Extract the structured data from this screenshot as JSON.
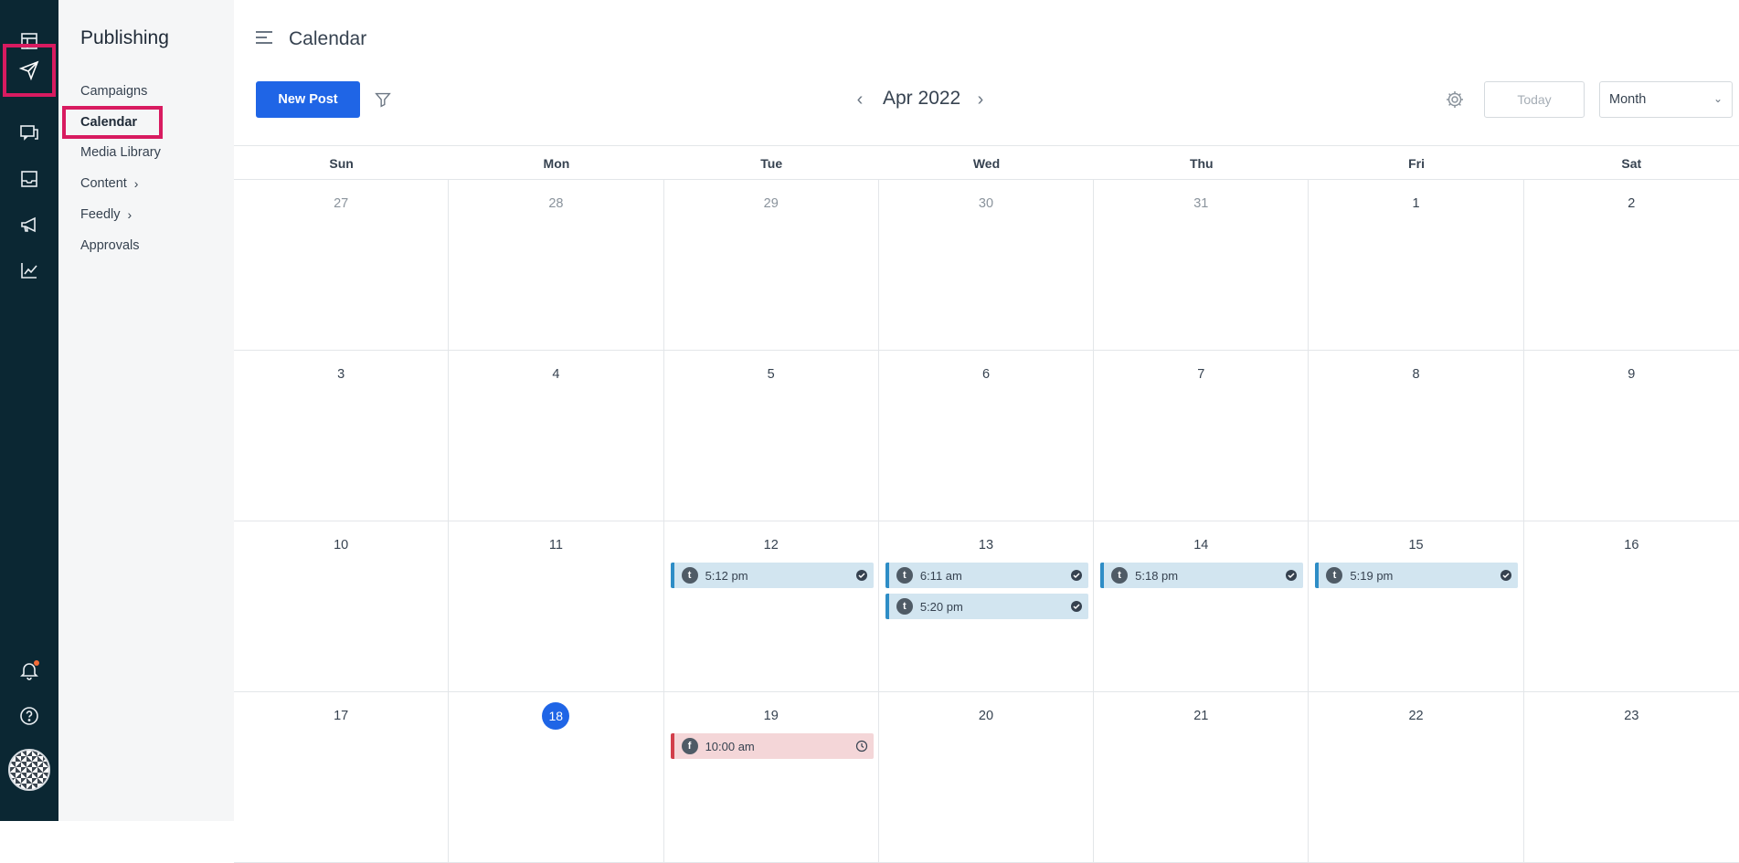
{
  "sidebar": {
    "title": "Publishing",
    "items": [
      {
        "label": "Campaigns"
      },
      {
        "label": "Calendar"
      },
      {
        "label": "Media Library"
      },
      {
        "label": "Content"
      },
      {
        "label": "Feedly"
      },
      {
        "label": "Approvals"
      }
    ]
  },
  "header": {
    "title": "Calendar",
    "new_post_label": "New Post",
    "month_label": "Apr 2022",
    "today_label": "Today",
    "view_selected": "Month"
  },
  "calendar": {
    "days_of_week": [
      "Sun",
      "Mon",
      "Tue",
      "Wed",
      "Thu",
      "Fri",
      "Sat"
    ],
    "weeks": [
      [
        "27",
        "28",
        "29",
        "30",
        "31",
        "1",
        "2"
      ],
      [
        "3",
        "4",
        "5",
        "6",
        "7",
        "8",
        "9"
      ],
      [
        "10",
        "11",
        "12",
        "13",
        "14",
        "15",
        "16"
      ],
      [
        "17",
        "18",
        "19",
        "20",
        "21",
        "22",
        "23"
      ]
    ],
    "today": "18",
    "events": {
      "tue12": "5:12 pm",
      "wed13a": "6:11 am",
      "wed13b": "5:20 pm",
      "thu14": "5:18 pm",
      "fri15": "5:19 pm",
      "tue19": "10:00 am"
    }
  },
  "colors": {
    "rail_bg": "#0b2733",
    "accent_blue": "#1f65e6",
    "highlight": "#d81b60",
    "twitter_event": "#d2e5f0",
    "facebook_event": "#f4d6d8"
  }
}
